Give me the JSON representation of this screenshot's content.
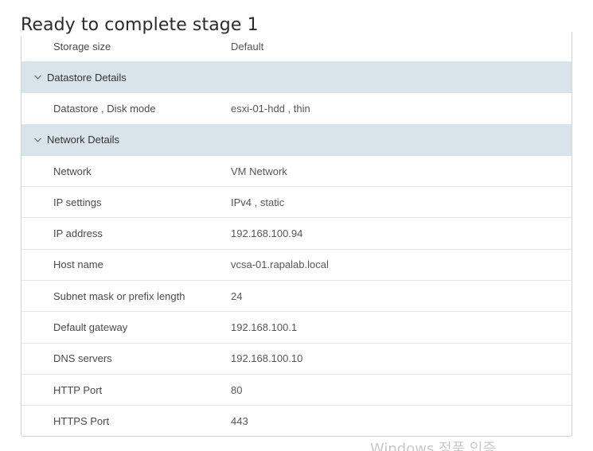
{
  "page": {
    "title": "Ready to complete stage 1"
  },
  "rows_top": [
    {
      "label": "Storage size",
      "value": "Default"
    }
  ],
  "sections": [
    {
      "title": "Datastore Details",
      "rows": [
        {
          "label": "Datastore , Disk mode",
          "value": "esxi-01-hdd , thin"
        }
      ]
    },
    {
      "title": "Network Details",
      "rows": [
        {
          "label": "Network",
          "value": "VM Network"
        },
        {
          "label": "IP settings",
          "value": "IPv4 , static"
        },
        {
          "label": "IP address",
          "value": "192.168.100.94"
        },
        {
          "label": "Host name",
          "value": "vcsa-01.rapalab.local"
        },
        {
          "label": "Subnet mask or prefix length",
          "value": "24"
        },
        {
          "label": "Default gateway",
          "value": "192.168.100.1"
        },
        {
          "label": "DNS servers",
          "value": "192.168.100.10"
        },
        {
          "label": "HTTP Port",
          "value": "80"
        },
        {
          "label": "HTTPS Port",
          "value": "443"
        }
      ]
    }
  ],
  "watermark": {
    "text": "Windows 정품 인증"
  },
  "icons": {
    "section_toggle": "chevron-down-icon"
  },
  "colors": {
    "section_bg": "#d9e4ea",
    "border": "#d3d3d3",
    "row_divider": "#e6e6e6"
  }
}
